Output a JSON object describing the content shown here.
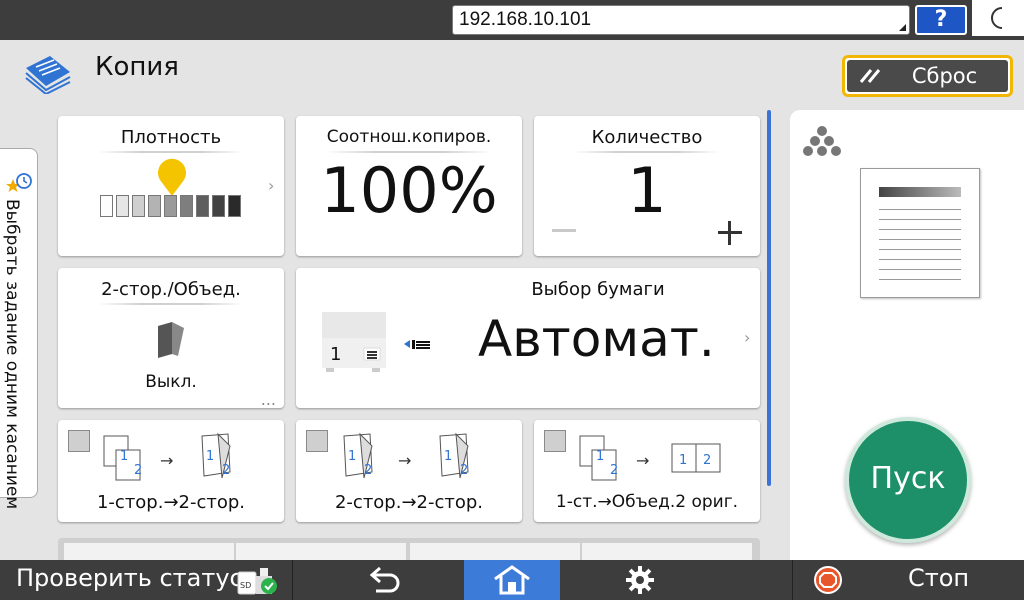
{
  "topbar": {
    "ip_address": "192.168.10.101",
    "help_label": "?",
    "help_icon": "question-icon",
    "night_icon": "moon-icon"
  },
  "header": {
    "app_title": "Копия",
    "app_icon": "copy-document-icon",
    "reset_label": "Сброс",
    "reset_icon": "double-slash-icon"
  },
  "side_tab": {
    "label": "Выбрать задание одним касанием",
    "icon": "star-clock-icon"
  },
  "tiles": {
    "density": {
      "title": "Плотность",
      "level_fraction": 0.5,
      "steps": 9
    },
    "ratio": {
      "title": "Соотнош.копиров.",
      "value": "100%"
    },
    "quantity": {
      "title": "Количество",
      "value": "1",
      "minus": "−",
      "plus": "+"
    },
    "duplex": {
      "title": "2-стор./Объед.",
      "value": "Выкл.",
      "more": "..."
    },
    "paper": {
      "title": "Выбор бумаги",
      "value": "Автомат.",
      "tray_number": "1"
    }
  },
  "duplex_presets": [
    {
      "label": "1-стор.→2-стор.",
      "from": "1 2",
      "to": "1 2"
    },
    {
      "label": "2-стор.→2-стор.",
      "from": "1 2",
      "to": "1 2"
    },
    {
      "label": "1-ст.→Объед.2 ориг.",
      "from": "1 2",
      "to_left": "1",
      "to_right": "2"
    }
  ],
  "preview": {
    "color_icon": "toner-dots-icon",
    "start_label": "Пуск"
  },
  "statusbar": {
    "check_status": "Проверить статус",
    "sd_icon": "sd-card-check-icon",
    "back_icon": "back-arrow-icon",
    "home_icon": "home-icon",
    "settings_icon": "gear-icon",
    "stop_icon": "stop-icon",
    "stop_label": "Стоп"
  },
  "colors": {
    "topbar": "#3d3d3d",
    "accent_blue": "#3d7bd9",
    "start_green": "#1d8f69",
    "reset_border": "#f2b705",
    "density_marker": "#f5c400"
  }
}
